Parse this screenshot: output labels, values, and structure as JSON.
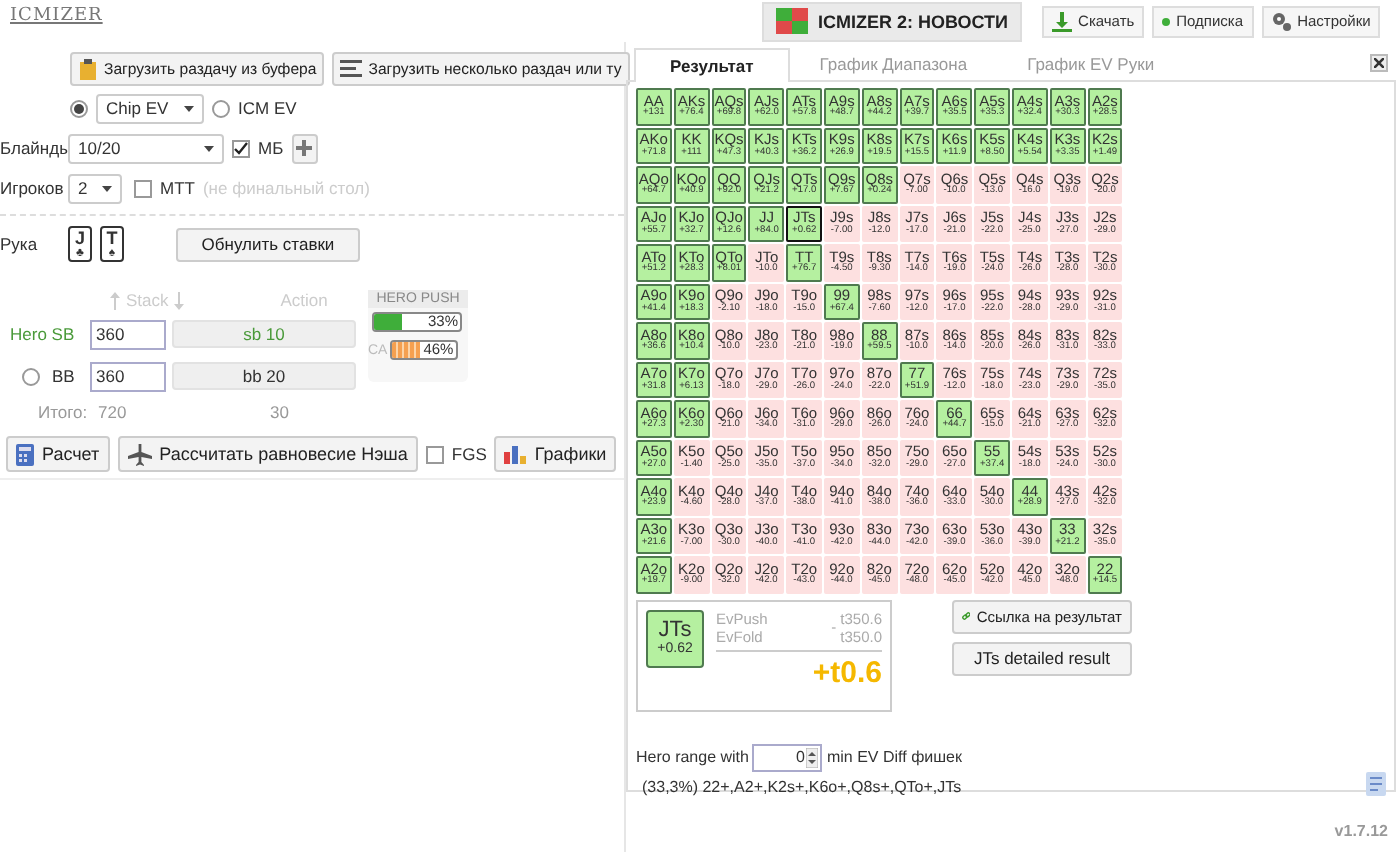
{
  "header": {
    "logo": "ICMIZER",
    "news_button": "ICMIZER 2: НОВОСТИ",
    "buttons": [
      {
        "kind": "download",
        "label": "Скачать"
      },
      {
        "kind": "subscribe",
        "label": "Подписка"
      },
      {
        "kind": "settings",
        "label": "Настройки"
      }
    ]
  },
  "left": {
    "load_buttons": [
      {
        "kind": "clipboard",
        "label": "Загрузить раздачу из буфера"
      },
      {
        "kind": "list",
        "label": "Загрузить несколько раздач или ту"
      }
    ],
    "ev_modes": [
      {
        "kind": "select",
        "label": "Chip EV",
        "selected": true
      },
      {
        "kind": "plain",
        "label": "ICM EV",
        "selected": false
      }
    ],
    "blinds": {
      "label": "Блайнды",
      "value": "10/20",
      "mb_label": "МБ",
      "mb_checked": true
    },
    "players": {
      "label": "Игроков",
      "value": "2",
      "mtt_label": "МТТ",
      "mtt_checked": false,
      "mtt_note": "(не финальный стол)"
    },
    "hand": {
      "label": "Рука",
      "cards": [
        {
          "rank": "J",
          "suit": "♣"
        },
        {
          "rank": "T",
          "suit": "♠"
        }
      ],
      "reset_button": "Обнулить ставки"
    },
    "stack_header": "Stack",
    "action_header": "Action",
    "seats": [
      {
        "name": "Hero SB",
        "selected": true,
        "stack": "360",
        "action": "sb 10"
      },
      {
        "name": "BB",
        "selected": false,
        "stack": "360",
        "action": "bb 20"
      }
    ],
    "totals": {
      "label": "Итого:",
      "stack": "720",
      "action": "30"
    },
    "hero_push": {
      "title": "HERO PUSH",
      "push": {
        "reading": "33%",
        "level": 0.33
      },
      "call_label": "CA",
      "call": {
        "reading": "46%",
        "level": 0.46
      }
    },
    "actions": [
      {
        "kind": "calc",
        "label": "Расчет"
      },
      {
        "kind": "nash",
        "label": "Рассчитать равновесие Нэша"
      },
      {
        "kind": "checkbox",
        "label": "FGS",
        "checked": false
      },
      {
        "kind": "charts",
        "label": "Графики"
      }
    ]
  },
  "tabs": [
    {
      "label": "Результат",
      "selected": true
    },
    {
      "label": "График Диапазона",
      "selected": false
    },
    {
      "label": "График EV Руки",
      "selected": false
    }
  ],
  "grid": [
    [
      {
        "hand": "AA",
        "ev": "+131",
        "push": true,
        "selected": false
      },
      {
        "hand": "AKs",
        "ev": "+76.4",
        "push": true,
        "selected": false
      },
      {
        "hand": "AQs",
        "ev": "+69.8",
        "push": true,
        "selected": false
      },
      {
        "hand": "AJs",
        "ev": "+62.0",
        "push": true,
        "selected": false
      },
      {
        "hand": "ATs",
        "ev": "+57.8",
        "push": true,
        "selected": false
      },
      {
        "hand": "A9s",
        "ev": "+48.7",
        "push": true,
        "selected": false
      },
      {
        "hand": "A8s",
        "ev": "+44.2",
        "push": true,
        "selected": false
      },
      {
        "hand": "A7s",
        "ev": "+39.7",
        "push": true,
        "selected": false
      },
      {
        "hand": "A6s",
        "ev": "+35.5",
        "push": true,
        "selected": false
      },
      {
        "hand": "A5s",
        "ev": "+35.3",
        "push": true,
        "selected": false
      },
      {
        "hand": "A4s",
        "ev": "+32.4",
        "push": true,
        "selected": false
      },
      {
        "hand": "A3s",
        "ev": "+30.3",
        "push": true,
        "selected": false
      },
      {
        "hand": "A2s",
        "ev": "+28.5",
        "push": true,
        "selected": false
      }
    ],
    [
      {
        "hand": "AKo",
        "ev": "+71.8",
        "push": true,
        "selected": false
      },
      {
        "hand": "KK",
        "ev": "+111",
        "push": true,
        "selected": false
      },
      {
        "hand": "KQs",
        "ev": "+47.3",
        "push": true,
        "selected": false
      },
      {
        "hand": "KJs",
        "ev": "+40.3",
        "push": true,
        "selected": false
      },
      {
        "hand": "KTs",
        "ev": "+36.2",
        "push": true,
        "selected": false
      },
      {
        "hand": "K9s",
        "ev": "+26.9",
        "push": true,
        "selected": false
      },
      {
        "hand": "K8s",
        "ev": "+19.5",
        "push": true,
        "selected": false
      },
      {
        "hand": "K7s",
        "ev": "+15.5",
        "push": true,
        "selected": false
      },
      {
        "hand": "K6s",
        "ev": "+11.9",
        "push": true,
        "selected": false
      },
      {
        "hand": "K5s",
        "ev": "+8.50",
        "push": true,
        "selected": false
      },
      {
        "hand": "K4s",
        "ev": "+5.54",
        "push": true,
        "selected": false
      },
      {
        "hand": "K3s",
        "ev": "+3.35",
        "push": true,
        "selected": false
      },
      {
        "hand": "K2s",
        "ev": "+1.49",
        "push": true,
        "selected": false
      }
    ],
    [
      {
        "hand": "AQo",
        "ev": "+64.7",
        "push": true,
        "selected": false
      },
      {
        "hand": "KQo",
        "ev": "+40.9",
        "push": true,
        "selected": false
      },
      {
        "hand": "QQ",
        "ev": "+92.0",
        "push": true,
        "selected": false
      },
      {
        "hand": "QJs",
        "ev": "+21.2",
        "push": true,
        "selected": false
      },
      {
        "hand": "QTs",
        "ev": "+17.0",
        "push": true,
        "selected": false
      },
      {
        "hand": "Q9s",
        "ev": "+7.67",
        "push": true,
        "selected": false
      },
      {
        "hand": "Q8s",
        "ev": "+0.24",
        "push": true,
        "selected": false
      },
      {
        "hand": "Q7s",
        "ev": "-7.00",
        "push": false,
        "selected": false
      },
      {
        "hand": "Q6s",
        "ev": "-10.0",
        "push": false,
        "selected": false
      },
      {
        "hand": "Q5s",
        "ev": "-13.0",
        "push": false,
        "selected": false
      },
      {
        "hand": "Q4s",
        "ev": "-16.0",
        "push": false,
        "selected": false
      },
      {
        "hand": "Q3s",
        "ev": "-19.0",
        "push": false,
        "selected": false
      },
      {
        "hand": "Q2s",
        "ev": "-20.0",
        "push": false,
        "selected": false
      }
    ],
    [
      {
        "hand": "AJo",
        "ev": "+55.7",
        "push": true,
        "selected": false
      },
      {
        "hand": "KJo",
        "ev": "+32.7",
        "push": true,
        "selected": false
      },
      {
        "hand": "QJo",
        "ev": "+12.6",
        "push": true,
        "selected": false
      },
      {
        "hand": "JJ",
        "ev": "+84.0",
        "push": true,
        "selected": false
      },
      {
        "hand": "JTs",
        "ev": "+0.62",
        "push": true,
        "selected": true
      },
      {
        "hand": "J9s",
        "ev": "-7.00",
        "push": false,
        "selected": false
      },
      {
        "hand": "J8s",
        "ev": "-12.0",
        "push": false,
        "selected": false
      },
      {
        "hand": "J7s",
        "ev": "-17.0",
        "push": false,
        "selected": false
      },
      {
        "hand": "J6s",
        "ev": "-21.0",
        "push": false,
        "selected": false
      },
      {
        "hand": "J5s",
        "ev": "-22.0",
        "push": false,
        "selected": false
      },
      {
        "hand": "J4s",
        "ev": "-25.0",
        "push": false,
        "selected": false
      },
      {
        "hand": "J3s",
        "ev": "-27.0",
        "push": false,
        "selected": false
      },
      {
        "hand": "J2s",
        "ev": "-29.0",
        "push": false,
        "selected": false
      }
    ],
    [
      {
        "hand": "ATo",
        "ev": "+51.2",
        "push": true,
        "selected": false
      },
      {
        "hand": "KTo",
        "ev": "+28.3",
        "push": true,
        "selected": false
      },
      {
        "hand": "QTo",
        "ev": "+8.01",
        "push": true,
        "selected": false
      },
      {
        "hand": "JTo",
        "ev": "-10.0",
        "push": false,
        "selected": false
      },
      {
        "hand": "TT",
        "ev": "+76.7",
        "push": true,
        "selected": false
      },
      {
        "hand": "T9s",
        "ev": "-4.50",
        "push": false,
        "selected": false
      },
      {
        "hand": "T8s",
        "ev": "-9.30",
        "push": false,
        "selected": false
      },
      {
        "hand": "T7s",
        "ev": "-14.0",
        "push": false,
        "selected": false
      },
      {
        "hand": "T6s",
        "ev": "-19.0",
        "push": false,
        "selected": false
      },
      {
        "hand": "T5s",
        "ev": "-24.0",
        "push": false,
        "selected": false
      },
      {
        "hand": "T4s",
        "ev": "-26.0",
        "push": false,
        "selected": false
      },
      {
        "hand": "T3s",
        "ev": "-28.0",
        "push": false,
        "selected": false
      },
      {
        "hand": "T2s",
        "ev": "-30.0",
        "push": false,
        "selected": false
      }
    ],
    [
      {
        "hand": "A9o",
        "ev": "+41.4",
        "push": true,
        "selected": false
      },
      {
        "hand": "K9o",
        "ev": "+18.3",
        "push": true,
        "selected": false
      },
      {
        "hand": "Q9o",
        "ev": "-2.10",
        "push": false,
        "selected": false
      },
      {
        "hand": "J9o",
        "ev": "-18.0",
        "push": false,
        "selected": false
      },
      {
        "hand": "T9o",
        "ev": "-15.0",
        "push": false,
        "selected": false
      },
      {
        "hand": "99",
        "ev": "+67.4",
        "push": true,
        "selected": false
      },
      {
        "hand": "98s",
        "ev": "-7.60",
        "push": false,
        "selected": false
      },
      {
        "hand": "97s",
        "ev": "-12.0",
        "push": false,
        "selected": false
      },
      {
        "hand": "96s",
        "ev": "-17.0",
        "push": false,
        "selected": false
      },
      {
        "hand": "95s",
        "ev": "-22.0",
        "push": false,
        "selected": false
      },
      {
        "hand": "94s",
        "ev": "-28.0",
        "push": false,
        "selected": false
      },
      {
        "hand": "93s",
        "ev": "-29.0",
        "push": false,
        "selected": false
      },
      {
        "hand": "92s",
        "ev": "-31.0",
        "push": false,
        "selected": false
      }
    ],
    [
      {
        "hand": "A8o",
        "ev": "+36.6",
        "push": true,
        "selected": false
      },
      {
        "hand": "K8o",
        "ev": "+10.4",
        "push": true,
        "selected": false
      },
      {
        "hand": "Q8o",
        "ev": "-10.0",
        "push": false,
        "selected": false
      },
      {
        "hand": "J8o",
        "ev": "-23.0",
        "push": false,
        "selected": false
      },
      {
        "hand": "T8o",
        "ev": "-21.0",
        "push": false,
        "selected": false
      },
      {
        "hand": "98o",
        "ev": "-19.0",
        "push": false,
        "selected": false
      },
      {
        "hand": "88",
        "ev": "+59.5",
        "push": true,
        "selected": false
      },
      {
        "hand": "87s",
        "ev": "-10.0",
        "push": false,
        "selected": false
      },
      {
        "hand": "86s",
        "ev": "-14.0",
        "push": false,
        "selected": false
      },
      {
        "hand": "85s",
        "ev": "-20.0",
        "push": false,
        "selected": false
      },
      {
        "hand": "84s",
        "ev": "-26.0",
        "push": false,
        "selected": false
      },
      {
        "hand": "83s",
        "ev": "-31.0",
        "push": false,
        "selected": false
      },
      {
        "hand": "82s",
        "ev": "-33.0",
        "push": false,
        "selected": false
      }
    ],
    [
      {
        "hand": "A7o",
        "ev": "+31.8",
        "push": true,
        "selected": false
      },
      {
        "hand": "K7o",
        "ev": "+6.13",
        "push": true,
        "selected": false
      },
      {
        "hand": "Q7o",
        "ev": "-18.0",
        "push": false,
        "selected": false
      },
      {
        "hand": "J7o",
        "ev": "-29.0",
        "push": false,
        "selected": false
      },
      {
        "hand": "T7o",
        "ev": "-26.0",
        "push": false,
        "selected": false
      },
      {
        "hand": "97o",
        "ev": "-24.0",
        "push": false,
        "selected": false
      },
      {
        "hand": "87o",
        "ev": "-22.0",
        "push": false,
        "selected": false
      },
      {
        "hand": "77",
        "ev": "+51.9",
        "push": true,
        "selected": false
      },
      {
        "hand": "76s",
        "ev": "-12.0",
        "push": false,
        "selected": false
      },
      {
        "hand": "75s",
        "ev": "-18.0",
        "push": false,
        "selected": false
      },
      {
        "hand": "74s",
        "ev": "-23.0",
        "push": false,
        "selected": false
      },
      {
        "hand": "73s",
        "ev": "-29.0",
        "push": false,
        "selected": false
      },
      {
        "hand": "72s",
        "ev": "-35.0",
        "push": false,
        "selected": false
      }
    ],
    [
      {
        "hand": "A6o",
        "ev": "+27.3",
        "push": true,
        "selected": false
      },
      {
        "hand": "K6o",
        "ev": "+2.30",
        "push": true,
        "selected": false
      },
      {
        "hand": "Q6o",
        "ev": "-21.0",
        "push": false,
        "selected": false
      },
      {
        "hand": "J6o",
        "ev": "-34.0",
        "push": false,
        "selected": false
      },
      {
        "hand": "T6o",
        "ev": "-31.0",
        "push": false,
        "selected": false
      },
      {
        "hand": "96o",
        "ev": "-29.0",
        "push": false,
        "selected": false
      },
      {
        "hand": "86o",
        "ev": "-26.0",
        "push": false,
        "selected": false
      },
      {
        "hand": "76o",
        "ev": "-24.0",
        "push": false,
        "selected": false
      },
      {
        "hand": "66",
        "ev": "+44.7",
        "push": true,
        "selected": false
      },
      {
        "hand": "65s",
        "ev": "-15.0",
        "push": false,
        "selected": false
      },
      {
        "hand": "64s",
        "ev": "-21.0",
        "push": false,
        "selected": false
      },
      {
        "hand": "63s",
        "ev": "-27.0",
        "push": false,
        "selected": false
      },
      {
        "hand": "62s",
        "ev": "-32.0",
        "push": false,
        "selected": false
      }
    ],
    [
      {
        "hand": "A5o",
        "ev": "+27.0",
        "push": true,
        "selected": false
      },
      {
        "hand": "K5o",
        "ev": "-1.40",
        "push": false,
        "selected": false
      },
      {
        "hand": "Q5o",
        "ev": "-25.0",
        "push": false,
        "selected": false
      },
      {
        "hand": "J5o",
        "ev": "-35.0",
        "push": false,
        "selected": false
      },
      {
        "hand": "T5o",
        "ev": "-37.0",
        "push": false,
        "selected": false
      },
      {
        "hand": "95o",
        "ev": "-34.0",
        "push": false,
        "selected": false
      },
      {
        "hand": "85o",
        "ev": "-32.0",
        "push": false,
        "selected": false
      },
      {
        "hand": "75o",
        "ev": "-29.0",
        "push": false,
        "selected": false
      },
      {
        "hand": "65o",
        "ev": "-27.0",
        "push": false,
        "selected": false
      },
      {
        "hand": "55",
        "ev": "+37.4",
        "push": true,
        "selected": false
      },
      {
        "hand": "54s",
        "ev": "-18.0",
        "push": false,
        "selected": false
      },
      {
        "hand": "53s",
        "ev": "-24.0",
        "push": false,
        "selected": false
      },
      {
        "hand": "52s",
        "ev": "-30.0",
        "push": false,
        "selected": false
      }
    ],
    [
      {
        "hand": "A4o",
        "ev": "+23.9",
        "push": true,
        "selected": false
      },
      {
        "hand": "K4o",
        "ev": "-4.60",
        "push": false,
        "selected": false
      },
      {
        "hand": "Q4o",
        "ev": "-28.0",
        "push": false,
        "selected": false
      },
      {
        "hand": "J4o",
        "ev": "-37.0",
        "push": false,
        "selected": false
      },
      {
        "hand": "T4o",
        "ev": "-38.0",
        "push": false,
        "selected": false
      },
      {
        "hand": "94o",
        "ev": "-41.0",
        "push": false,
        "selected": false
      },
      {
        "hand": "84o",
        "ev": "-38.0",
        "push": false,
        "selected": false
      },
      {
        "hand": "74o",
        "ev": "-36.0",
        "push": false,
        "selected": false
      },
      {
        "hand": "64o",
        "ev": "-33.0",
        "push": false,
        "selected": false
      },
      {
        "hand": "54o",
        "ev": "-30.0",
        "push": false,
        "selected": false
      },
      {
        "hand": "44",
        "ev": "+28.9",
        "push": true,
        "selected": false
      },
      {
        "hand": "43s",
        "ev": "-27.0",
        "push": false,
        "selected": false
      },
      {
        "hand": "42s",
        "ev": "-32.0",
        "push": false,
        "selected": false
      }
    ],
    [
      {
        "hand": "A3o",
        "ev": "+21.6",
        "push": true,
        "selected": false
      },
      {
        "hand": "K3o",
        "ev": "-7.00",
        "push": false,
        "selected": false
      },
      {
        "hand": "Q3o",
        "ev": "-30.0",
        "push": false,
        "selected": false
      },
      {
        "hand": "J3o",
        "ev": "-40.0",
        "push": false,
        "selected": false
      },
      {
        "hand": "T3o",
        "ev": "-41.0",
        "push": false,
        "selected": false
      },
      {
        "hand": "93o",
        "ev": "-42.0",
        "push": false,
        "selected": false
      },
      {
        "hand": "83o",
        "ev": "-44.0",
        "push": false,
        "selected": false
      },
      {
        "hand": "73o",
        "ev": "-42.0",
        "push": false,
        "selected": false
      },
      {
        "hand": "63o",
        "ev": "-39.0",
        "push": false,
        "selected": false
      },
      {
        "hand": "53o",
        "ev": "-36.0",
        "push": false,
        "selected": false
      },
      {
        "hand": "43o",
        "ev": "-39.0",
        "push": false,
        "selected": false
      },
      {
        "hand": "33",
        "ev": "+21.2",
        "push": true,
        "selected": false
      },
      {
        "hand": "32s",
        "ev": "-35.0",
        "push": false,
        "selected": false
      }
    ],
    [
      {
        "hand": "A2o",
        "ev": "+19.7",
        "push": true,
        "selected": false
      },
      {
        "hand": "K2o",
        "ev": "-9.00",
        "push": false,
        "selected": false
      },
      {
        "hand": "Q2o",
        "ev": "-32.0",
        "push": false,
        "selected": false
      },
      {
        "hand": "J2o",
        "ev": "-42.0",
        "push": false,
        "selected": false
      },
      {
        "hand": "T2o",
        "ev": "-43.0",
        "push": false,
        "selected": false
      },
      {
        "hand": "92o",
        "ev": "-44.0",
        "push": false,
        "selected": false
      },
      {
        "hand": "82o",
        "ev": "-45.0",
        "push": false,
        "selected": false
      },
      {
        "hand": "72o",
        "ev": "-48.0",
        "push": false,
        "selected": false
      },
      {
        "hand": "62o",
        "ev": "-45.0",
        "push": false,
        "selected": false
      },
      {
        "hand": "52o",
        "ev": "-42.0",
        "push": false,
        "selected": false
      },
      {
        "hand": "42o",
        "ev": "-45.0",
        "push": false,
        "selected": false
      },
      {
        "hand": "32o",
        "ev": "-48.0",
        "push": false,
        "selected": false
      },
      {
        "hand": "22",
        "ev": "+14.5",
        "push": true,
        "selected": false
      }
    ]
  ],
  "result": {
    "hand": "JTs",
    "ev": "+0.62",
    "ev_push_label": "EvPush",
    "ev_push": "t350.6",
    "ev_fold_label": "EvFold",
    "ev_fold": "t350.0",
    "minus": "-",
    "diff": "+t0.6"
  },
  "link_button": "Ссылка на результат",
  "detail_button": "JTs detailed result",
  "range_filter": {
    "label": "Hero range with",
    "value": "0",
    "suffix": "min EV Diff фишек"
  },
  "range_text": "(33,3%) 22+,A2+,K2s+,K6o+,Q8s+,QTo+,JTs",
  "version": "v1.7.12"
}
